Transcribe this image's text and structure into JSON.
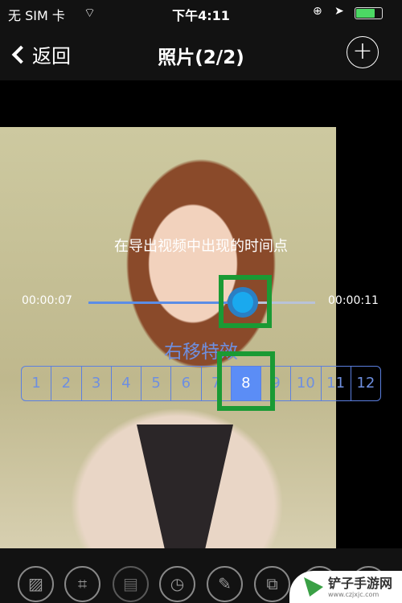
{
  "status": {
    "carrier": "无 SIM 卡",
    "time": "下午4:11",
    "battery_level": 0.75
  },
  "nav": {
    "back_label": "返回",
    "title": "照片(2/2)",
    "add_label": "+"
  },
  "editor": {
    "hint": "在导出视频中出现的时间点",
    "start_time": "00:00:07",
    "end_time": "00:00:11",
    "slider_fraction": 0.68,
    "effect_label": "右移特效",
    "segments": [
      "1",
      "2",
      "3",
      "4",
      "5",
      "6",
      "7",
      "8",
      "9",
      "10",
      "11",
      "12"
    ],
    "selected_segment": "8"
  },
  "toolbar": [
    "image-icon",
    "crop-icon",
    "save-icon",
    "clock-icon",
    "pencil-icon",
    "share-icon",
    "more-icon",
    "more-icon-2"
  ],
  "watermark": {
    "name": "铲子手游网",
    "url": "www.czjxjc.com"
  },
  "colors": {
    "accent": "#5b8df6",
    "highlight": "#1a9a34",
    "thumb": "#1aa9ee"
  }
}
